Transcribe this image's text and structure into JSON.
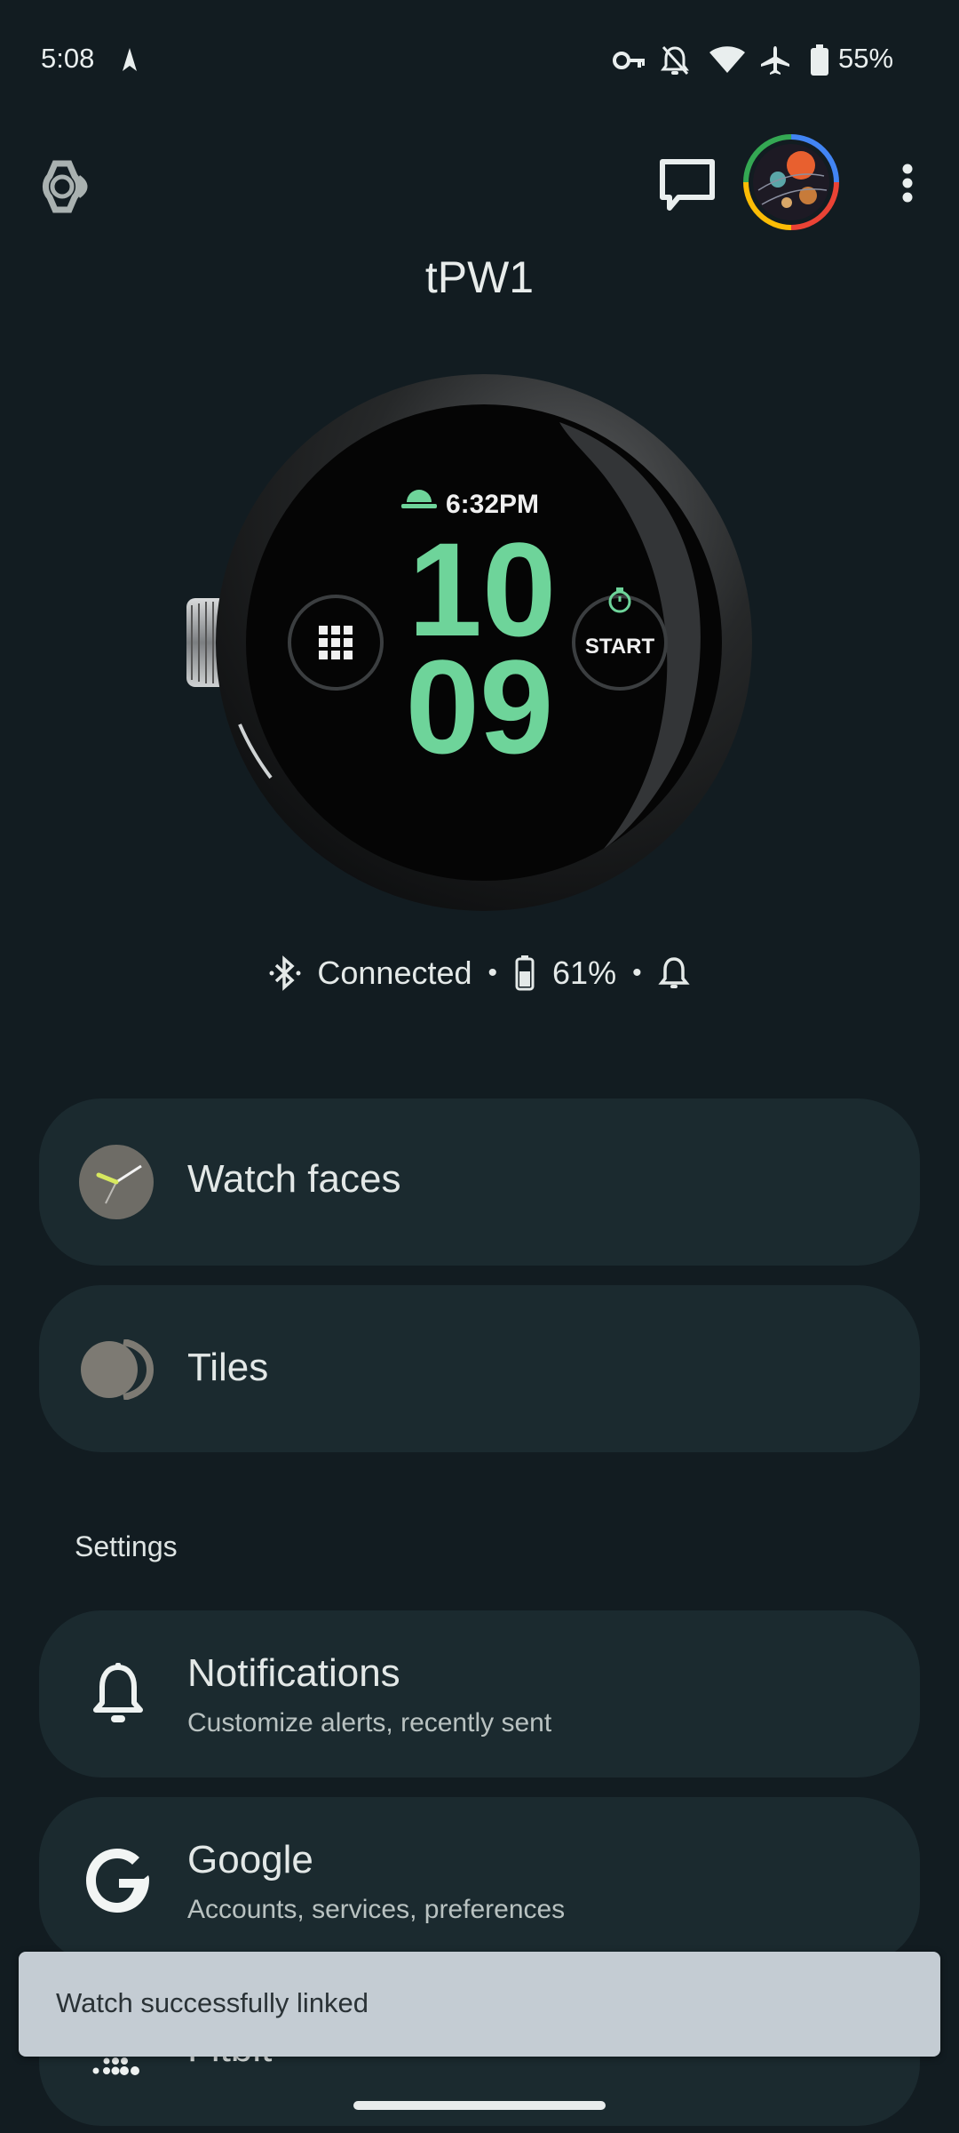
{
  "status_bar": {
    "time": "5:08",
    "battery_percent": "55%",
    "icons": [
      "navigation-icon",
      "vpn-key-icon",
      "notifications-off-icon",
      "wifi-icon",
      "airplane-mode-icon",
      "battery-icon"
    ]
  },
  "app_bar": {
    "watch_name": "tPW1",
    "icons": [
      "watch-logo-icon",
      "feedback-icon",
      "account-avatar",
      "more-vert-icon"
    ]
  },
  "watch_face": {
    "top_time": "6:32PM",
    "hours": "10",
    "minutes": "09",
    "start_label": "START",
    "accent_color": "#6ed49a"
  },
  "watch_status": {
    "connection": "Connected",
    "battery": "61%"
  },
  "menu": {
    "watch_faces": "Watch faces",
    "tiles": "Tiles"
  },
  "settings": {
    "section_label": "Settings",
    "notifications_title": "Notifications",
    "notifications_sub": "Customize alerts, recently sent",
    "google_title": "Google",
    "google_sub": "Accounts, services, preferences",
    "fitbit_title": "Fitbit"
  },
  "snackbar": {
    "message": "Watch successfully linked"
  },
  "colors": {
    "background": "#121c21",
    "card": "#1b2a2f",
    "snackbar": "#c4ccd3",
    "accent_green": "#6ed49a"
  }
}
